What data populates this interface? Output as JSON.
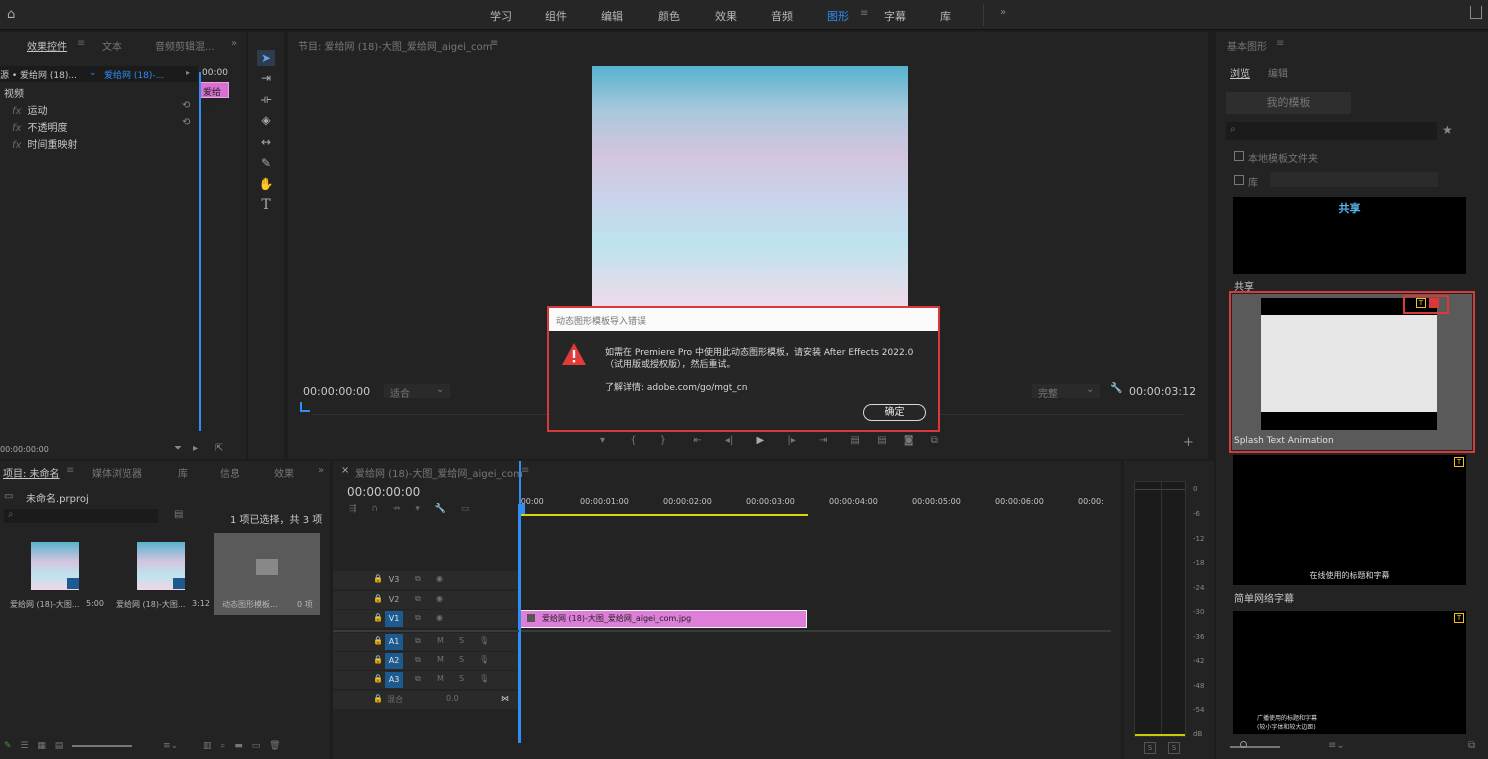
{
  "topbar": {
    "workspaces": [
      "学习",
      "组件",
      "编辑",
      "颜色",
      "效果",
      "音频",
      "图形",
      "字幕",
      "库"
    ],
    "active": "图形",
    "more": "»"
  },
  "effect_controls": {
    "tabs": [
      "效果控件",
      "文本",
      "音频剪辑混..."
    ],
    "source_label": "源 • 爱给网 (18)...",
    "clip_label": "爱给网 (18)-...",
    "time_start": "00:00",
    "mini_clip": "爱给网",
    "section": "视频",
    "effects": [
      "运动",
      "不透明度",
      "时间重映射"
    ],
    "fx": "fx",
    "timecode": "00:00:00:00"
  },
  "program": {
    "title": "节目: 爱给网 (18)-大图_爱给网_aigei_com",
    "timecode_left": "00:00:00:00",
    "fit": "适合",
    "quality": "完整",
    "timecode_right": "00:00:03:12"
  },
  "dialog": {
    "title": "动态图形模板导入错误",
    "line1": "如需在 Premiere Pro 中使用此动态图形模板，请安装 After Effects 2022.0",
    "line2": "（试用版或授权版），然后重试。",
    "details": "了解详情: adobe.com/go/mgt_cn",
    "ok": "确定"
  },
  "essential_graphics": {
    "title": "基本图形",
    "tabs": [
      "浏览",
      "编辑"
    ],
    "my_templates": "我的模板",
    "local_folder": "本地模板文件夹",
    "library": "库",
    "card1_title": "共享",
    "label1": "共享",
    "card2_label": "Splash Text Animation",
    "card3_text": "在线使用的标题和字幕",
    "label3": "简单网络字幕",
    "card4_line1": "广播使用的标题和字幕",
    "card4_line2": "(较小字体和较大边距)"
  },
  "project": {
    "tabs": [
      "项目: 未命名",
      "媒体浏览器",
      "库",
      "信息",
      "效果"
    ],
    "file": "未命名.prproj",
    "selection": "1 项已选择，共 3 项",
    "items": [
      {
        "name": "爱给网 (18)-大图...",
        "dur": "5:00"
      },
      {
        "name": "爱给网 (18)-大图...",
        "dur": "3:12"
      },
      {
        "name": "动态图形模板...",
        "dur": "0 项"
      }
    ]
  },
  "timeline": {
    "title": "爱给网 (18)-大图_爱给网_aigei_com",
    "timecode": "00:00:00:00",
    "ruler": [
      ":00:00",
      "00:00:01:00",
      "00:00:02:00",
      "00:00:03:00",
      "00:00:04:00",
      "00:00:05:00",
      "00:00:06:00",
      "00:00:"
    ],
    "tracks": [
      "V3",
      "V2",
      "V1",
      "A1",
      "A2",
      "A3"
    ],
    "mix": "混合",
    "mix_val": "0.0",
    "clip": "爱给网 (18)-大图_爱给网_aigei_com.jpg",
    "m": "M",
    "s": "S"
  },
  "meter": {
    "db": [
      "0",
      "-6",
      "-12",
      "-18",
      "-24",
      "-30",
      "-36",
      "-42",
      "-48",
      "-54",
      "dB"
    ],
    "s": "S"
  }
}
